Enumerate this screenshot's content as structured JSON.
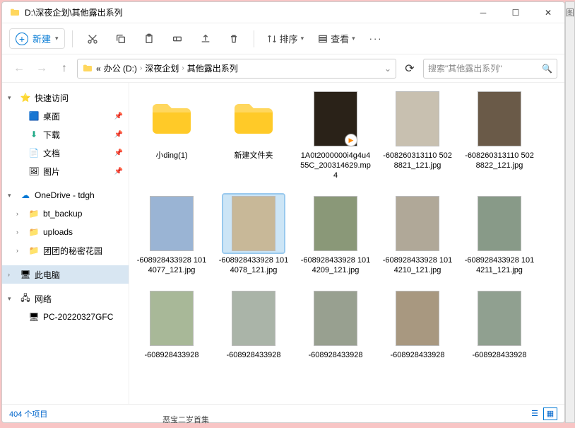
{
  "title": "D:\\深夜企划\\其他露出系列",
  "toolbar": {
    "new": "新建",
    "sort": "排序",
    "view": "查看"
  },
  "breadcrumb": {
    "pre": "«",
    "parts": [
      "办公 (D:)",
      "深夜企划",
      "其他露出系列"
    ]
  },
  "search_placeholder": "搜索\"其他露出系列\"",
  "sidebar": {
    "quick": "快速访问",
    "desktop": "桌面",
    "downloads": "下载",
    "documents": "文档",
    "pictures": "图片",
    "onedrive": "OneDrive - tdgh",
    "bt": "bt_backup",
    "uploads": "uploads",
    "team": "团团的秘密花园",
    "thispc": "此电脑",
    "network": "网络",
    "pc1": "PC-20220327GFC"
  },
  "items": [
    {
      "type": "folder",
      "name": "小ding(1)"
    },
    {
      "type": "folder",
      "name": "新建文件夹"
    },
    {
      "type": "video",
      "name": "1A0t2000000i4g4u455C_200314629.mp4",
      "bg": "#2a2218"
    },
    {
      "type": "img",
      "name": "-608260313110 5028821_121.jpg",
      "bg": "#c8c0b0"
    },
    {
      "type": "img",
      "name": "-608260313110 5028822_121.jpg",
      "bg": "#6a5a48"
    },
    {
      "type": "img",
      "name": "-608928433928 1014077_121.jpg",
      "bg": "#9ab4d4"
    },
    {
      "type": "img",
      "name": "-608928433928 1014078_121.jpg",
      "bg": "#c8b898",
      "sel": true
    },
    {
      "type": "img",
      "name": "-608928433928 1014209_121.jpg",
      "bg": "#8a9878"
    },
    {
      "type": "img",
      "name": "-608928433928 1014210_121.jpg",
      "bg": "#b0a898"
    },
    {
      "type": "img",
      "name": "-608928433928 1014211_121.jpg",
      "bg": "#889a88"
    },
    {
      "type": "img",
      "name": "-608928433928",
      "bg": "#a8b898"
    },
    {
      "type": "img",
      "name": "-608928433928",
      "bg": "#aab4a8"
    },
    {
      "type": "img",
      "name": "-608928433928",
      "bg": "#98a090"
    },
    {
      "type": "img",
      "name": "-608928433928",
      "bg": "#a89880"
    },
    {
      "type": "img",
      "name": "-608928433928",
      "bg": "#90a090"
    }
  ],
  "status": "404 个项目",
  "bottom_hidden": "恶宝二岁首集",
  "edge": "图"
}
